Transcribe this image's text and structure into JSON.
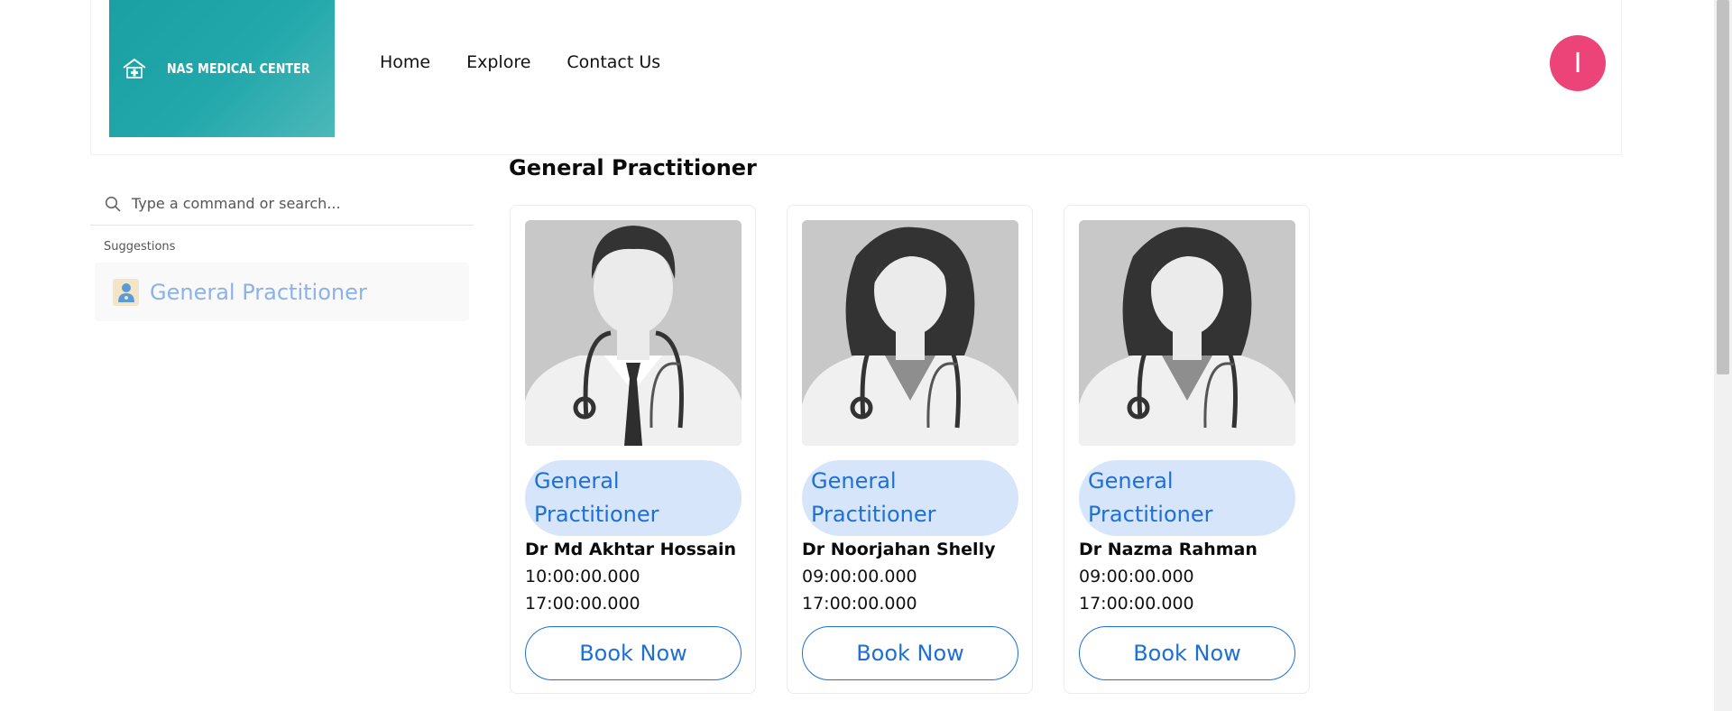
{
  "header": {
    "logo_text": "NAS MEDICAL CENTER",
    "nav": [
      "Home",
      "Explore",
      "Contact Us"
    ],
    "avatar_initial": "I"
  },
  "command": {
    "placeholder": "Type a command or search...",
    "suggestions_title": "Suggestions",
    "suggestion_label": "General Practitioner"
  },
  "main": {
    "section_title": "General Practitioner",
    "doctors": [
      {
        "specialty": "General Practitioner",
        "name": "Dr Md Akhtar Hossain",
        "start": "10:00:00.000",
        "end": "17:00:00.000",
        "button": "Book Now",
        "avatar": "male-doctor"
      },
      {
        "specialty": "General Practitioner",
        "name": "Dr Noorjahan Shelly",
        "start": "09:00:00.000",
        "end": "17:00:00.000",
        "button": "Book Now",
        "avatar": "female-doctor"
      },
      {
        "specialty": "General Practitioner",
        "name": "Dr Nazma Rahman",
        "start": "09:00:00.000",
        "end": "17:00:00.000",
        "button": "Book Now",
        "avatar": "female-doctor"
      }
    ]
  },
  "colors": {
    "logo_teal": "#1a9fa3",
    "avatar_pink": "#ec4379",
    "accent_blue": "#1d70d6",
    "pill_blue": "#d7e5fb",
    "suggestion_text": "#8cb2ea"
  }
}
